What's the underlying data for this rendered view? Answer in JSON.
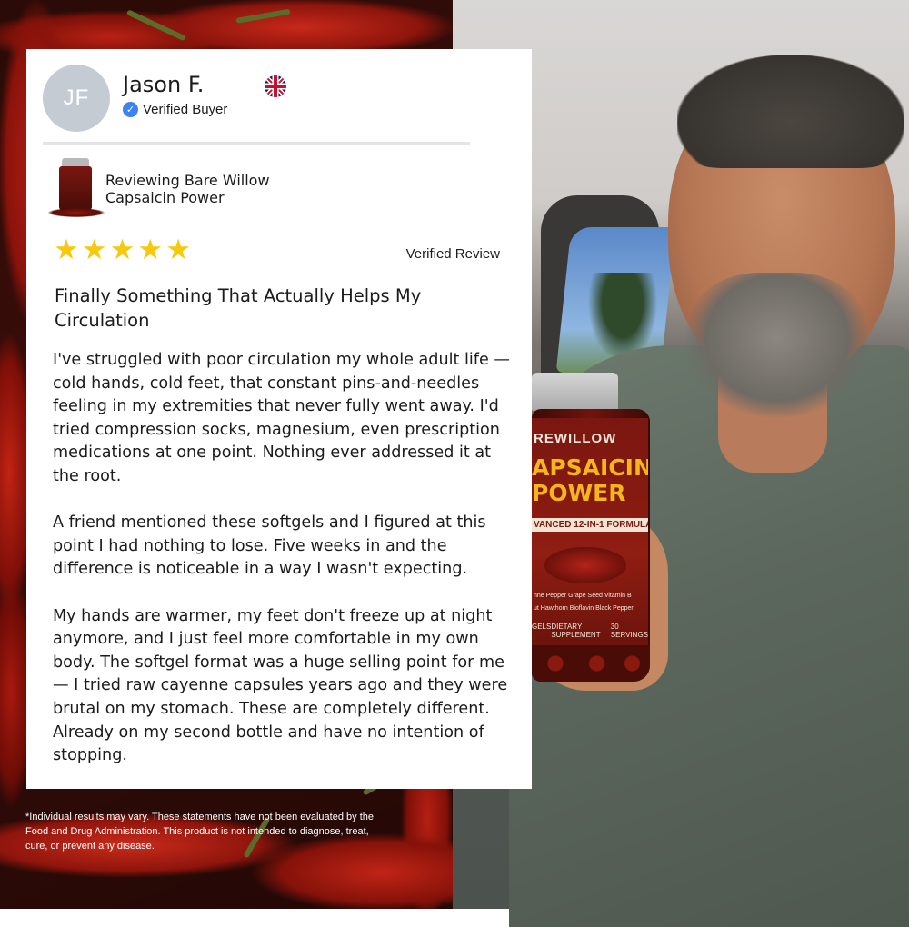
{
  "reviewer": {
    "initials": "JF",
    "name": "Jason F.",
    "badge": "Verified Buyer",
    "country_flag": "uk-flag-icon"
  },
  "product": {
    "reviewing_line1": "Reviewing Bare Willow",
    "reviewing_line2": "Capsaicin Power"
  },
  "rating": {
    "stars": 5,
    "max": 5,
    "star_glyph": "★",
    "label": "Verified Review"
  },
  "review": {
    "title": "Finally Something That Actually Helps My Circulation",
    "paragraphs": [
      "I've struggled with poor circulation my whole adult life — cold hands, cold feet, that constant pins-and-needles feeling in my extremities that never fully went away. I'd tried compression socks, magnesium, even prescription medications at one point. Nothing ever addressed it at the root.",
      "A friend mentioned these softgels and I figured at this point I had nothing to lose. Five weeks in and the difference is noticeable in a way I wasn't expecting.",
      "My hands are warmer, my feet don't freeze up at night anymore, and I just feel more comfortable in my own body. The softgel format was a huge selling point for me — I tried raw cayenne capsules years ago and they were brutal on my stomach. These are completely different. Already on my second bottle and have no intention of stopping."
    ]
  },
  "disclaimer": "*Individual results may vary. These statements have not been evaluated by the Food and Drug Administration. This product is not intended to diagnose, treat, cure, or prevent any disease.",
  "bottle_label": {
    "brand": "REWILLOW",
    "title_line1": "APSAICIN",
    "title_line2": "POWER",
    "subtitle": "VANCED 12-IN-1 FORMULA",
    "row1": "nne Pepper  Grape Seed  Vitamin B",
    "row2": "ut  Hawthorn  Bioflavin  Black Pepper",
    "foot": [
      "GELS",
      "DIETARY SUPPLEMENT",
      "30 SERVINGS"
    ]
  },
  "colors": {
    "star": "#f6c90e",
    "verified_check": "#3b82f6",
    "avatar_bg": "#c5cbd3",
    "label_gold": "#f4b51d",
    "chili_red": "#b31d12"
  }
}
